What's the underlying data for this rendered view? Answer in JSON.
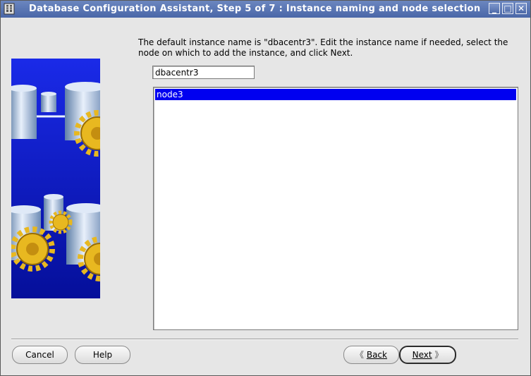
{
  "window": {
    "title": "Database Configuration Assistant, Step 5 of 7 : Instance naming and node selection",
    "controls": {
      "minimize": "_",
      "maximize": "□",
      "close": "✕"
    },
    "icon": "database-app-icon"
  },
  "instructions": "The default instance name is \"dbacentr3\". Edit the instance name if needed, select the node on which to add the instance, and click Next.",
  "instance_name": {
    "value": "dbacentr3"
  },
  "nodes": {
    "items": [
      "node3"
    ],
    "selected": "node3",
    "selection_color": "#0000f0"
  },
  "buttons": {
    "cancel": "Cancel",
    "help": "Help",
    "back": "Back",
    "next": "Next",
    "back_glyph": "《",
    "next_glyph": "》"
  },
  "colors": {
    "titlebar": "#4a67a8",
    "illustration_bg": "#0a18c8",
    "gear": "#e8b820"
  }
}
